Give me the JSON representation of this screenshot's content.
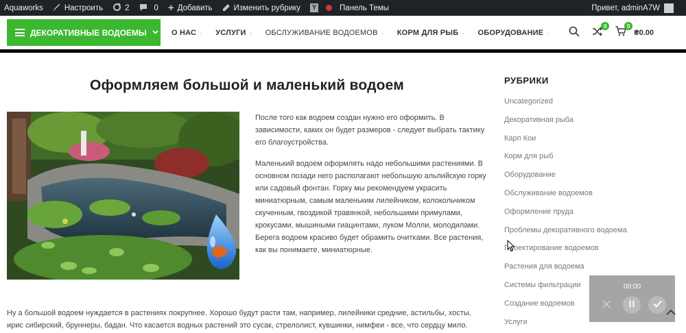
{
  "adminbar": {
    "site_name": "Aquaworks",
    "customize": "Настроить",
    "updates_count": "2",
    "comments_count": "0",
    "add_new": "Добавить",
    "edit_rubric": "Изменить рубрику",
    "theme_panel": "Панель Темы",
    "greeting": "Привет, adminA7W"
  },
  "header": {
    "categories_button": "ДЕКОРАТИВНЫЕ ВОДОЕМЫ",
    "nav": [
      "О НАС",
      "УСЛУГИ",
      "ОБСЛУЖИВАНИЕ ВОДОЕМОВ",
      "КОРМ ДЛЯ РЫБ",
      "ОБОРУДОВАНИЕ"
    ],
    "compare_count": "0",
    "cart_count": "0",
    "cart_total": "₴0.00"
  },
  "post": {
    "title": "Оформляем большой и маленький водоем",
    "para1": "После того как водоем создан нужно его оформить. В зависимости, каких он будет размеров - следует выбрать тактику его благоустройства.",
    "para2": "Маленький водоем оформлять надо небольшими растениями. В основном позади него располагают небольшую альпийскую горку или садовый фонтан. Горку мы рекомендуем украсить миниатюрным, самым маленьким лилейником, колокольчиком скученным, гвоздикой травянкой, небольшими примулами, крокусами, мышиными гиацинтами, луком Молли, молодилами. Берега водоем красиво будет обрамить очитками. Все растения, как вы понимаете, миниатюрные.",
    "para3": "Ну а большой водоем нуждается в растениях покрупнее. Хорошо будут расти там, например, лилейники средние, астильбы, хосты, ирис сибирский, бруннеры, бадан. Что касается водных растений это сусак, стрелолист, кувшинки, нимфеи - все, что сердцу мило."
  },
  "sidebar": {
    "title": "РУБРИКИ",
    "items": [
      "Uncategorized",
      "Декоративная рыба",
      "Карп Кои",
      "Корм для рыб",
      "Оборудование",
      "Обслуживание водоемов",
      "Оформление пруда",
      "Проблемы декоративного водоема",
      "Проектирование водоемов",
      "Растения для водоема",
      "Системы фильтрации",
      "Создание водоемов",
      "Услуги"
    ]
  },
  "recorder": {
    "time": "00:00"
  },
  "colors": {
    "accent_green": "#3bb82f",
    "admin_bar": "#1d2327",
    "record_dot": "#d63638"
  }
}
